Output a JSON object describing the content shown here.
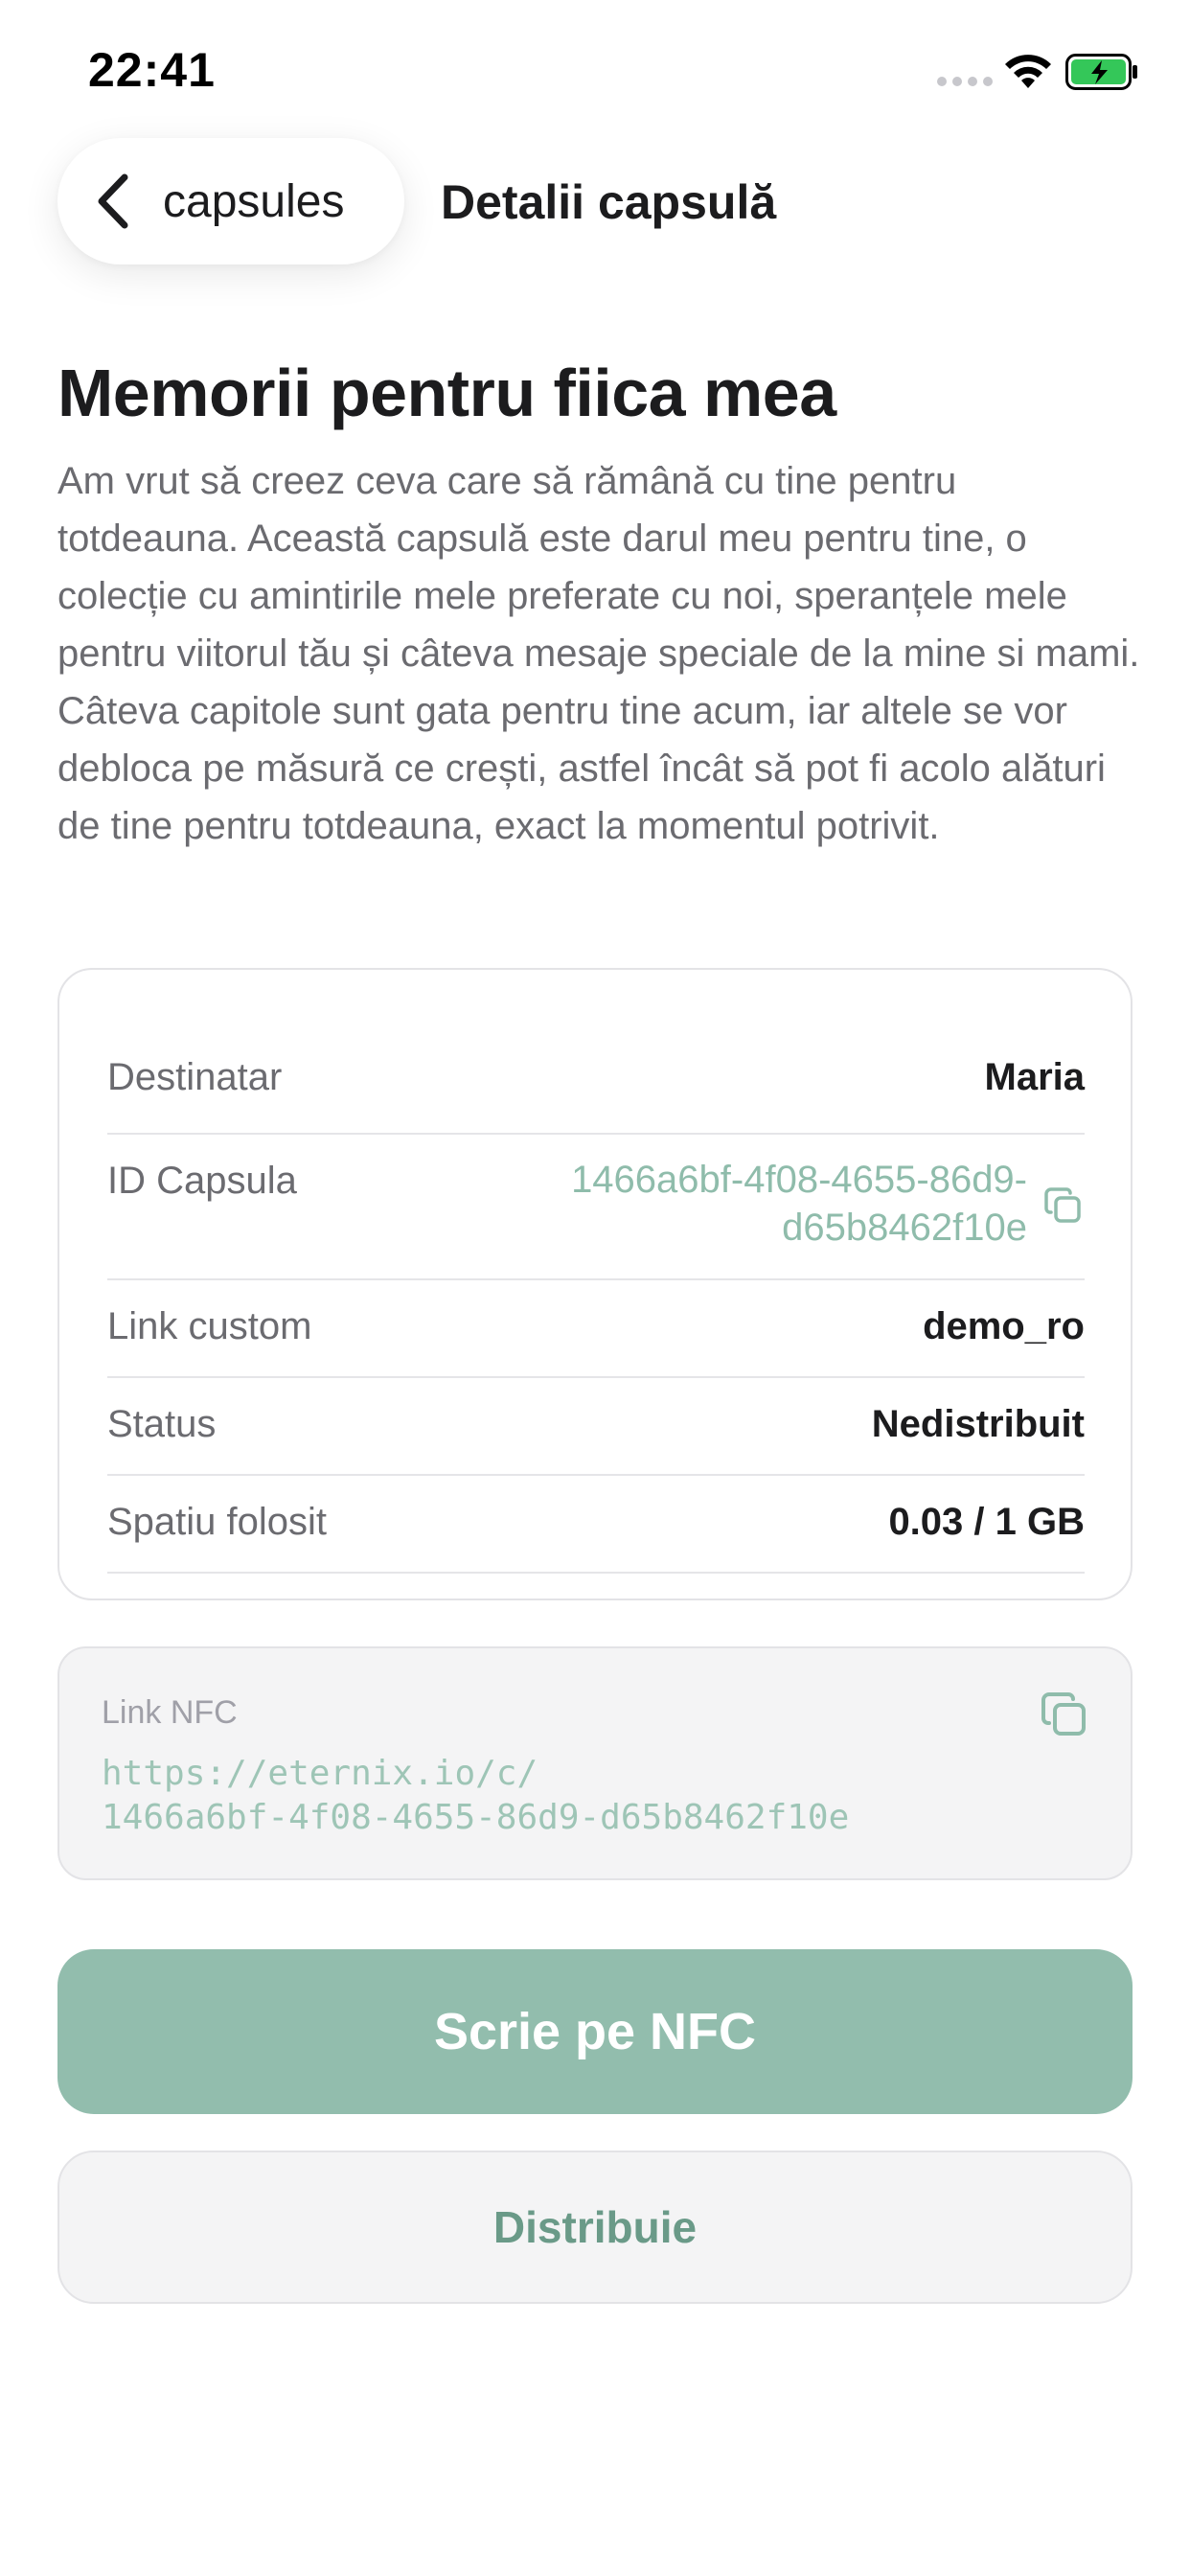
{
  "status_bar": {
    "time": "22:41",
    "battery_color": "#34c759"
  },
  "nav": {
    "back_label": "capsules",
    "title": "Detalii capsulă"
  },
  "capsule": {
    "title": "Memorii pentru fiica mea",
    "description": "Am vrut să creez ceva care să rămână cu tine pentru totdeauna. Această capsulă este darul meu pentru tine, o colecție cu amintirile mele preferate cu noi, speranțele mele pentru viitorul tău și câteva mesaje speciale de la mine si mami. Câteva capitole sunt gata pentru tine acum, iar altele se vor debloca pe măsură ce crești, astfel încât să pot fi acolo alături de tine pentru totdeauna, exact la momentul potrivit."
  },
  "details": {
    "recipient": {
      "label": "Destinatar",
      "value": "Maria"
    },
    "capsule_id": {
      "label": "ID Capsula",
      "value": "1466a6bf-4f08-4655-86d9-d65b8462f10e"
    },
    "custom_link": {
      "label": "Link custom",
      "value": "demo_ro"
    },
    "status": {
      "label": "Status",
      "value": "Nedistribuit"
    },
    "space_used": {
      "label": "Spatiu folosit",
      "value": "0.03 / 1 GB"
    }
  },
  "nfc": {
    "label": "Link NFC",
    "link": "https://eternix.io/c/\n1466a6bf-4f08-4655-86d9-d65b8462f10e"
  },
  "actions": {
    "write_nfc_label": "Scrie pe NFC",
    "distribute_label": "Distribuie"
  },
  "colors": {
    "accent": "#92bdad",
    "accent_text": "#8fbcab",
    "accent_dark": "#6a9a88"
  }
}
